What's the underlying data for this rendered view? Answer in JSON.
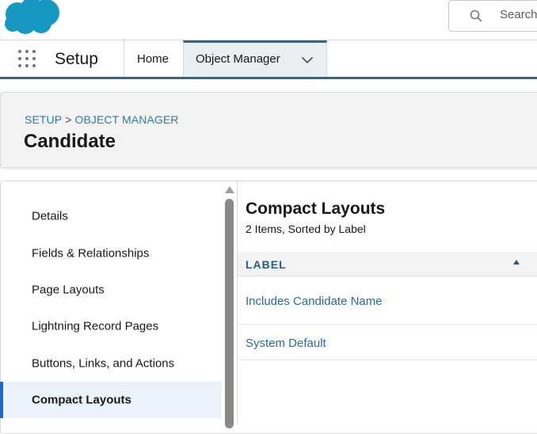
{
  "brand": {
    "logo": "salesforce-cloud-logo",
    "logo_color": "#1798c1"
  },
  "search": {
    "placeholder": "Search...",
    "icon": "search-icon"
  },
  "nav": {
    "app_launcher_icon": "app-launcher-icon",
    "app_name": "Setup",
    "tabs": [
      {
        "label": "Home",
        "active": false
      },
      {
        "label": "Object Manager",
        "active": true,
        "icon": "chevron-down-icon"
      }
    ],
    "accent_color": "#2a6a8f"
  },
  "header": {
    "breadcrumb": [
      "SETUP",
      "OBJECT MANAGER"
    ],
    "breadcrumb_separator": ">",
    "title": "Candidate"
  },
  "sidebar": {
    "items": [
      {
        "label": "Details",
        "active": false
      },
      {
        "label": "Fields & Relationships",
        "active": false
      },
      {
        "label": "Page Layouts",
        "active": false
      },
      {
        "label": "Lightning Record Pages",
        "active": false
      },
      {
        "label": "Buttons, Links, and Actions",
        "active": false
      },
      {
        "label": "Compact Layouts",
        "active": true
      }
    ],
    "active_color": "#1b6ac9"
  },
  "main": {
    "title": "Compact Layouts",
    "subtitle": "2 Items, Sorted by Label",
    "table": {
      "column_header": "LABEL",
      "sort": "ascending",
      "rows": [
        {
          "label": "Includes Candidate Name"
        },
        {
          "label": "System Default"
        }
      ]
    }
  }
}
